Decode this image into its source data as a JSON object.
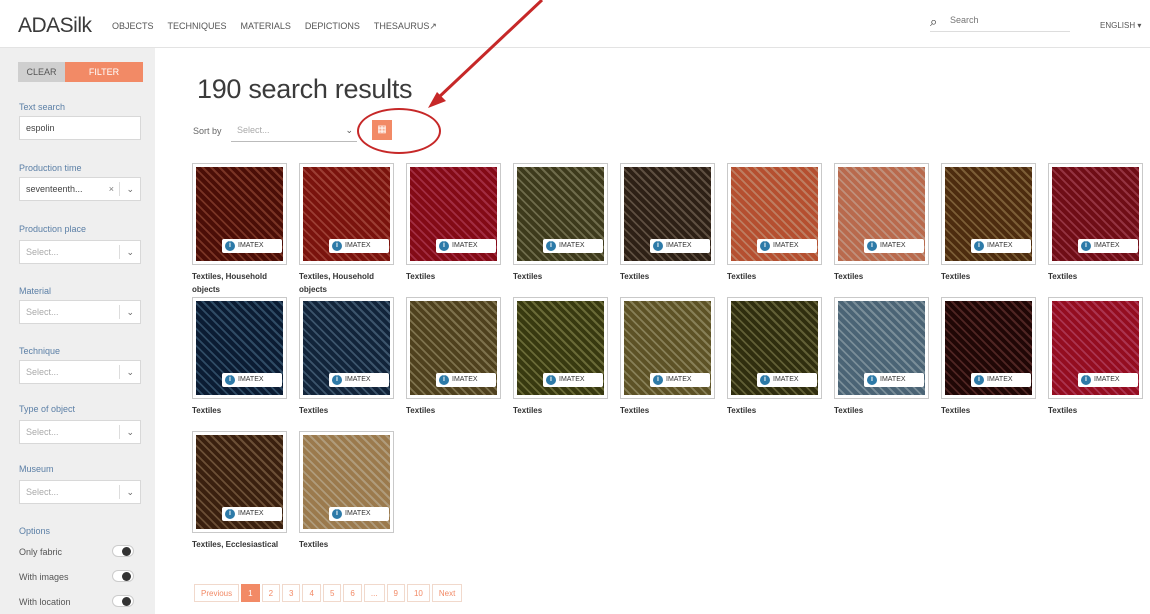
{
  "header": {
    "logo": "ADASilk",
    "nav": [
      "OBJECTS",
      "TECHNIQUES",
      "MATERIALS",
      "DEPICTIONS",
      "THESAURUS"
    ],
    "search_placeholder": "Search",
    "language": "ENGLISH ▾"
  },
  "sidebar": {
    "clear_label": "CLEAR",
    "filter_label": "FILTER",
    "text_search": {
      "label": "Text search",
      "value": "espolin"
    },
    "filters": [
      {
        "label": "Production time",
        "value": "seventeenth...",
        "placeholder": ""
      },
      {
        "label": "Production place",
        "value": "",
        "placeholder": "Select..."
      },
      {
        "label": "Material",
        "value": "",
        "placeholder": "Select..."
      },
      {
        "label": "Technique",
        "value": "",
        "placeholder": "Select..."
      },
      {
        "label": "Type of object",
        "value": "",
        "placeholder": "Select..."
      },
      {
        "label": "Museum",
        "value": "",
        "placeholder": "Select..."
      }
    ],
    "options_label": "Options",
    "options": [
      "Only fabric",
      "With images",
      "With location"
    ]
  },
  "main": {
    "title": "190 search results",
    "sort_label": "Sort by",
    "sort_placeholder": "Select...",
    "badge_text": "IMATEX",
    "results": [
      {
        "caption": "Textiles, Household objects",
        "color": "#8a3b2a"
      },
      {
        "caption": "Textiles, Household objects",
        "color": "#b0453a"
      },
      {
        "caption": "Textiles",
        "color": "#b7324a"
      },
      {
        "caption": "Textiles",
        "color": "#7d7a55"
      },
      {
        "caption": "Textiles",
        "color": "#6b5a4a"
      },
      {
        "caption": "Textiles",
        "color": "#d78e6e"
      },
      {
        "caption": "Textiles",
        "color": "#d9a48c"
      },
      {
        "caption": "Textiles",
        "color": "#8c6a3e"
      },
      {
        "caption": "Textiles",
        "color": "#a83a4a"
      },
      {
        "caption": "Textiles",
        "color": "#355572"
      },
      {
        "caption": "Textiles",
        "color": "#44607a"
      },
      {
        "caption": "Textiles",
        "color": "#8e8157"
      },
      {
        "caption": "Textiles",
        "color": "#78793f"
      },
      {
        "caption": "Textiles",
        "color": "#9a9163"
      },
      {
        "caption": "Textiles",
        "color": "#6e6c3d"
      },
      {
        "caption": "Textiles",
        "color": "#8aa0ad"
      },
      {
        "caption": "Textiles",
        "color": "#5a2a28"
      },
      {
        "caption": "Textiles",
        "color": "#c23a5a"
      },
      {
        "caption": "Textiles, Ecclesiastical",
        "color": "#7a5a3e"
      },
      {
        "caption": "Textiles",
        "color": "#c7b08c"
      }
    ],
    "pagination": [
      "Previous",
      "1",
      "2",
      "3",
      "4",
      "5",
      "6",
      "...",
      "9",
      "10",
      "Next"
    ],
    "active_page": "1"
  },
  "colors": {
    "accent": "#f28a66",
    "annotation": "#c62828",
    "sidebar_bg": "#efefef",
    "label_blue": "#5b7fa6"
  }
}
